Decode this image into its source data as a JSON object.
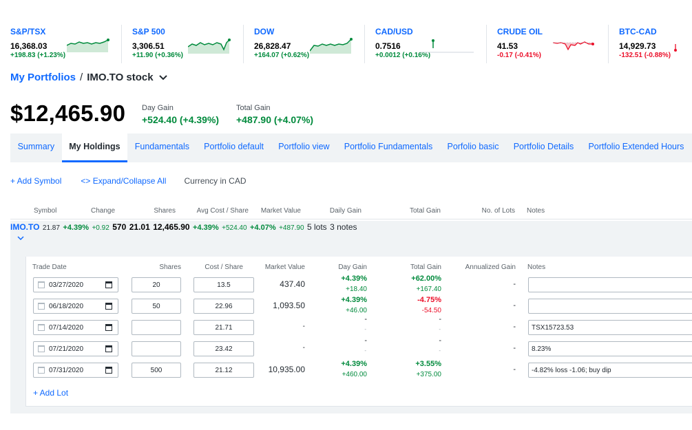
{
  "tickers": [
    {
      "name": "S&P/TSX",
      "price": "16,368.03",
      "change": "+198.83 (+1.23%)",
      "dir": "up"
    },
    {
      "name": "S&P 500",
      "price": "3,306.51",
      "change": "+11.90 (+0.36%)",
      "dir": "up"
    },
    {
      "name": "DOW",
      "price": "26,828.47",
      "change": "+164.07 (+0.62%)",
      "dir": "up"
    },
    {
      "name": "CAD/USD",
      "price": "0.7516",
      "change": "+0.0012 (+0.16%)",
      "dir": "up"
    },
    {
      "name": "CRUDE OIL",
      "price": "41.53",
      "change": "-0.17 (-0.41%)",
      "dir": "down"
    },
    {
      "name": "BTC-CAD",
      "price": "14,929.73",
      "change": "-132.51 (-0.88%)",
      "dir": "down"
    }
  ],
  "breadcrumb": {
    "parent": "My Portfolios",
    "separator": "/",
    "current": "IMO.TO stock"
  },
  "summary": {
    "total_value": "$12,465.90",
    "day_gain_label": "Day Gain",
    "day_gain": "+524.40 (+4.39%)",
    "total_gain_label": "Total Gain",
    "total_gain": "+487.90 (+4.07%)"
  },
  "tabs": [
    "Summary",
    "My Holdings",
    "Fundamentals",
    "Portfolio default",
    "Portfolio view",
    "Portfolio Fundamentals",
    "Porfolio basic",
    "Portfolio Details",
    "Portfolio Extended Hours"
  ],
  "active_tab": "My Holdings",
  "toolbar": {
    "add_symbol": "+ Add Symbol",
    "expand": "<> Expand/Collapse All",
    "currency": "Currency in CAD"
  },
  "columns": {
    "symbol": "Symbol",
    "change": "Change",
    "shares": "Shares",
    "avg_cost": "Avg Cost / Share",
    "market_value": "Market Value",
    "day_gain": "Daily Gain",
    "total_gain": "Total Gain",
    "lots": "No. of Lots",
    "notes": "Notes"
  },
  "holding": {
    "symbol": "IMO.TO",
    "price": "21.87",
    "change_pct": "+4.39%",
    "change_amt": "+0.92",
    "shares": "570",
    "avg_cost": "21.01",
    "market_value": "12,465.90",
    "day_gain_pct": "+4.39%",
    "day_gain_amt": "+524.40",
    "total_gain_pct": "+4.07%",
    "total_gain_amt": "+487.90",
    "lots": "5 lots",
    "notes": "3 notes"
  },
  "lot_columns": {
    "trade_date": "Trade Date",
    "shares": "Shares",
    "cost": "Cost / Share",
    "market_value": "Market Value",
    "day_gain": "Day Gain",
    "total_gain": "Total Gain",
    "annualized": "Annualized Gain",
    "notes": "Notes"
  },
  "lots": [
    {
      "date": "03/27/2020",
      "shares": "20",
      "cost": "13.5",
      "market_value": "437.40",
      "day_pct": "+4.39%",
      "day_amt": "+18.40",
      "total_pct": "+62.00%",
      "total_amt": "+167.40",
      "total_dir": "up",
      "annualized": "-",
      "note": ""
    },
    {
      "date": "06/18/2020",
      "shares": "50",
      "cost": "22.96",
      "market_value": "1,093.50",
      "day_pct": "+4.39%",
      "day_amt": "+46.00",
      "total_pct": "-4.75%",
      "total_amt": "-54.50",
      "total_dir": "down",
      "annualized": "-",
      "note": ""
    },
    {
      "date": "07/14/2020",
      "shares": "",
      "cost": "21.71",
      "market_value": "-",
      "day_pct": "-",
      "day_amt": "-",
      "total_pct": "-",
      "total_amt": "-",
      "total_dir": "none",
      "annualized": "-",
      "note": "TSX15723.53"
    },
    {
      "date": "07/21/2020",
      "shares": "",
      "cost": "23.42",
      "market_value": "-",
      "day_pct": "-",
      "day_amt": "-",
      "total_pct": "-",
      "total_amt": "-",
      "total_dir": "none",
      "annualized": "-",
      "note": "8.23%"
    },
    {
      "date": "07/31/2020",
      "shares": "500",
      "cost": "21.12",
      "market_value": "10,935.00",
      "day_pct": "+4.39%",
      "day_amt": "+460.00",
      "total_pct": "+3.55%",
      "total_amt": "+375.00",
      "total_dir": "up",
      "annualized": "-",
      "note": "-4.82% loss -1.06; buy dip"
    }
  ],
  "add_lot": "+ Add Lot",
  "colors": {
    "accent": "#0f69ff",
    "up": "#008a3c",
    "down": "#eb0f29"
  }
}
